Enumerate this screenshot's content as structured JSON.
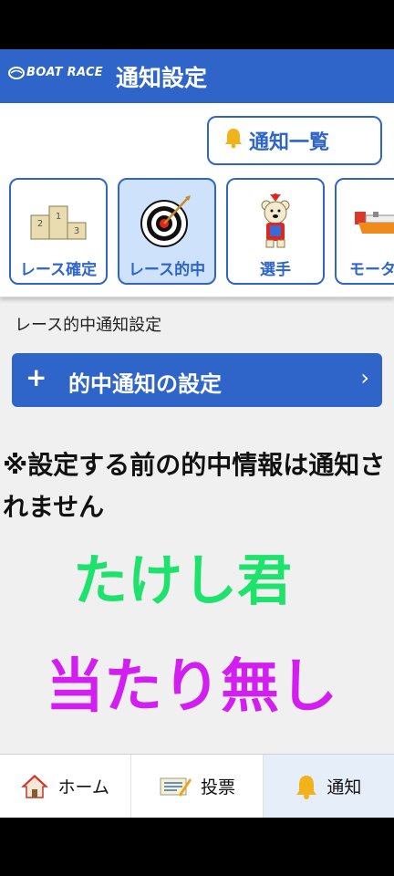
{
  "header": {
    "logo_text": "BOAT RACE",
    "title": "通知設定",
    "bg_color": "#2f64c8"
  },
  "notif_list_button": {
    "label": "通知一覧",
    "icon": "bell-icon"
  },
  "categories": [
    {
      "label": "レース確定",
      "icon": "podium-icon",
      "active": false
    },
    {
      "label": "レース的中",
      "icon": "target-icon",
      "active": true
    },
    {
      "label": "選手",
      "icon": "bear-mascot-icon",
      "active": false
    },
    {
      "label": "モーター",
      "icon": "boat-motor-icon",
      "active": false
    }
  ],
  "section_label": "レース的中通知設定",
  "hit_button": {
    "plus": "+",
    "label": "的中通知の設定",
    "chevron": "›"
  },
  "warning": "※設定する前の的中情報は通知されません",
  "overlay": {
    "line1": "たけし君",
    "line1_color": "#1de26c",
    "line2": "当たり無し",
    "line2_color": "#d21ef0"
  },
  "bottom_nav": [
    {
      "label": "ホーム",
      "icon": "home-icon"
    },
    {
      "label": "投票",
      "icon": "ticket-icon"
    },
    {
      "label": "通知",
      "icon": "bell-icon",
      "active": true
    }
  ]
}
